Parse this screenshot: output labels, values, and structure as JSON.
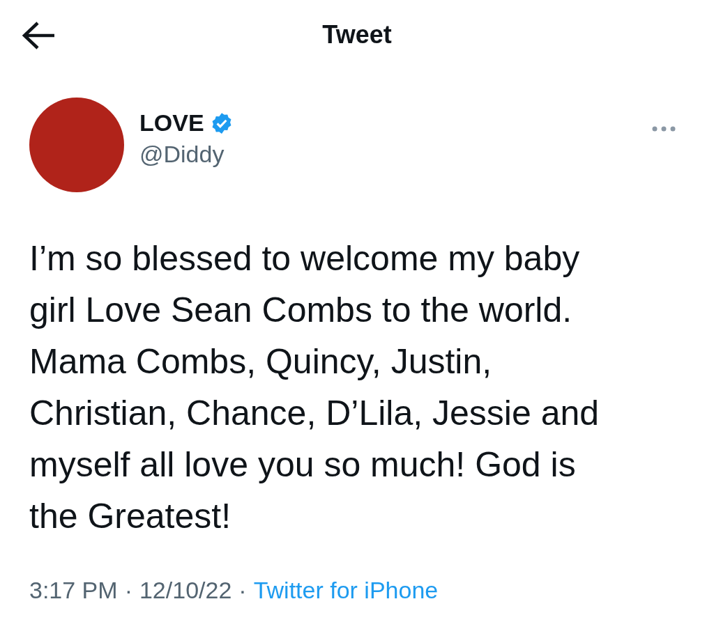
{
  "header": {
    "title": "Tweet"
  },
  "author": {
    "name": "LOVE",
    "verified": true,
    "handle": "@Diddy"
  },
  "tweet": {
    "lines": [
      "I’m so blessed to welcome my baby",
      "girl Love Sean Combs to the world.",
      "Mama Combs, Quincy, Justin,",
      "Christian, Chance, D’Lila, Jessie and",
      "myself all love you so much! God is",
      "the Greatest!"
    ]
  },
  "meta": {
    "time": "3:17 PM",
    "separator_1": "·",
    "date": "12/10/22",
    "separator_2": "·",
    "source": "Twitter for iPhone"
  }
}
